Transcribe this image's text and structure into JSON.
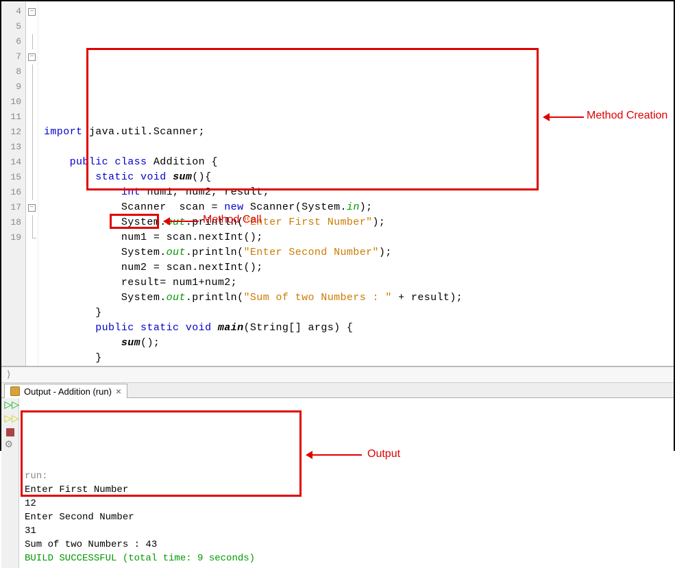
{
  "editor": {
    "line_start": 4,
    "lines": [
      {
        "n": 4,
        "fold": "box",
        "tokens": [
          {
            "t": "kw",
            "v": "import"
          },
          {
            "t": "plain",
            "v": " java.util.Scanner;"
          }
        ]
      },
      {
        "n": 5,
        "fold": "",
        "tokens": []
      },
      {
        "n": 6,
        "fold": "line",
        "indent": 1,
        "tokens": [
          {
            "t": "kw",
            "v": "public"
          },
          {
            "t": "plain",
            "v": " "
          },
          {
            "t": "kw",
            "v": "class"
          },
          {
            "t": "plain",
            "v": " "
          },
          {
            "t": "cls",
            "v": "Addition"
          },
          {
            "t": "plain",
            "v": " {"
          }
        ]
      },
      {
        "n": 7,
        "fold": "box",
        "indent": 2,
        "tokens": [
          {
            "t": "kw",
            "v": "static"
          },
          {
            "t": "plain",
            "v": " "
          },
          {
            "t": "kw",
            "v": "void"
          },
          {
            "t": "plain",
            "v": " "
          },
          {
            "t": "mname",
            "v": "sum"
          },
          {
            "t": "plain",
            "v": "(){"
          }
        ]
      },
      {
        "n": 8,
        "fold": "line",
        "indent": 3,
        "tokens": [
          {
            "t": "kw",
            "v": "int"
          },
          {
            "t": "plain",
            "v": " num1, num2, result;"
          }
        ]
      },
      {
        "n": 9,
        "fold": "line",
        "indent": 3,
        "tokens": [
          {
            "t": "plain",
            "v": "Scanner  scan = "
          },
          {
            "t": "kw",
            "v": "new"
          },
          {
            "t": "plain",
            "v": " Scanner(System."
          },
          {
            "t": "field",
            "v": "in"
          },
          {
            "t": "plain",
            "v": ");"
          }
        ]
      },
      {
        "n": 10,
        "fold": "line",
        "indent": 3,
        "tokens": [
          {
            "t": "plain",
            "v": "System."
          },
          {
            "t": "field",
            "v": "out"
          },
          {
            "t": "plain",
            "v": ".println("
          },
          {
            "t": "str",
            "v": "\"Enter First Number\""
          },
          {
            "t": "plain",
            "v": ");"
          }
        ]
      },
      {
        "n": 11,
        "fold": "line",
        "indent": 3,
        "tokens": [
          {
            "t": "plain",
            "v": "num1 = scan.nextInt();"
          }
        ]
      },
      {
        "n": 12,
        "fold": "line",
        "indent": 3,
        "tokens": [
          {
            "t": "plain",
            "v": "System."
          },
          {
            "t": "field",
            "v": "out"
          },
          {
            "t": "plain",
            "v": ".println("
          },
          {
            "t": "str",
            "v": "\"Enter Second Number\""
          },
          {
            "t": "plain",
            "v": ");"
          }
        ]
      },
      {
        "n": 13,
        "fold": "line",
        "indent": 3,
        "tokens": [
          {
            "t": "plain",
            "v": "num2 = scan.nextInt();"
          }
        ]
      },
      {
        "n": 14,
        "fold": "line",
        "indent": 3,
        "tokens": [
          {
            "t": "plain",
            "v": "result= num1+num2;"
          }
        ]
      },
      {
        "n": 15,
        "fold": "line",
        "indent": 3,
        "tokens": [
          {
            "t": "plain",
            "v": "System."
          },
          {
            "t": "field",
            "v": "out"
          },
          {
            "t": "plain",
            "v": ".println("
          },
          {
            "t": "str",
            "v": "\"Sum of two Numbers : \""
          },
          {
            "t": "plain",
            "v": " + result);"
          }
        ]
      },
      {
        "n": 16,
        "fold": "line",
        "indent": 2,
        "tokens": [
          {
            "t": "plain",
            "v": "}"
          }
        ]
      },
      {
        "n": 17,
        "fold": "box",
        "indent": 2,
        "tokens": [
          {
            "t": "kw",
            "v": "public"
          },
          {
            "t": "plain",
            "v": " "
          },
          {
            "t": "kw",
            "v": "static"
          },
          {
            "t": "plain",
            "v": " "
          },
          {
            "t": "kw",
            "v": "void"
          },
          {
            "t": "plain",
            "v": " "
          },
          {
            "t": "mname",
            "v": "main"
          },
          {
            "t": "plain",
            "v": "(String[] args) {"
          }
        ]
      },
      {
        "n": 18,
        "fold": "line",
        "indent": 3,
        "tokens": [
          {
            "t": "mname",
            "v": "sum"
          },
          {
            "t": "plain",
            "v": "();"
          }
        ]
      },
      {
        "n": 19,
        "fold": "end",
        "indent": 2,
        "tokens": [
          {
            "t": "plain",
            "v": "}"
          }
        ]
      }
    ]
  },
  "breadcrumb": "⟩",
  "output": {
    "tab_title": "Output - Addition (run)",
    "lines": [
      {
        "cls": "out-gray",
        "text": "run:"
      },
      {
        "cls": "",
        "text": "Enter First Number"
      },
      {
        "cls": "",
        "text": "12"
      },
      {
        "cls": "",
        "text": "Enter Second Number"
      },
      {
        "cls": "",
        "text": "31"
      },
      {
        "cls": "",
        "text": "Sum of two Numbers : 43"
      },
      {
        "cls": "out-green",
        "text": "BUILD SUCCESSFUL (total time: 9 seconds)"
      }
    ]
  },
  "annotations": {
    "method_creation": "Method Creation",
    "method_call": "Method Call",
    "output_label": "Output"
  }
}
